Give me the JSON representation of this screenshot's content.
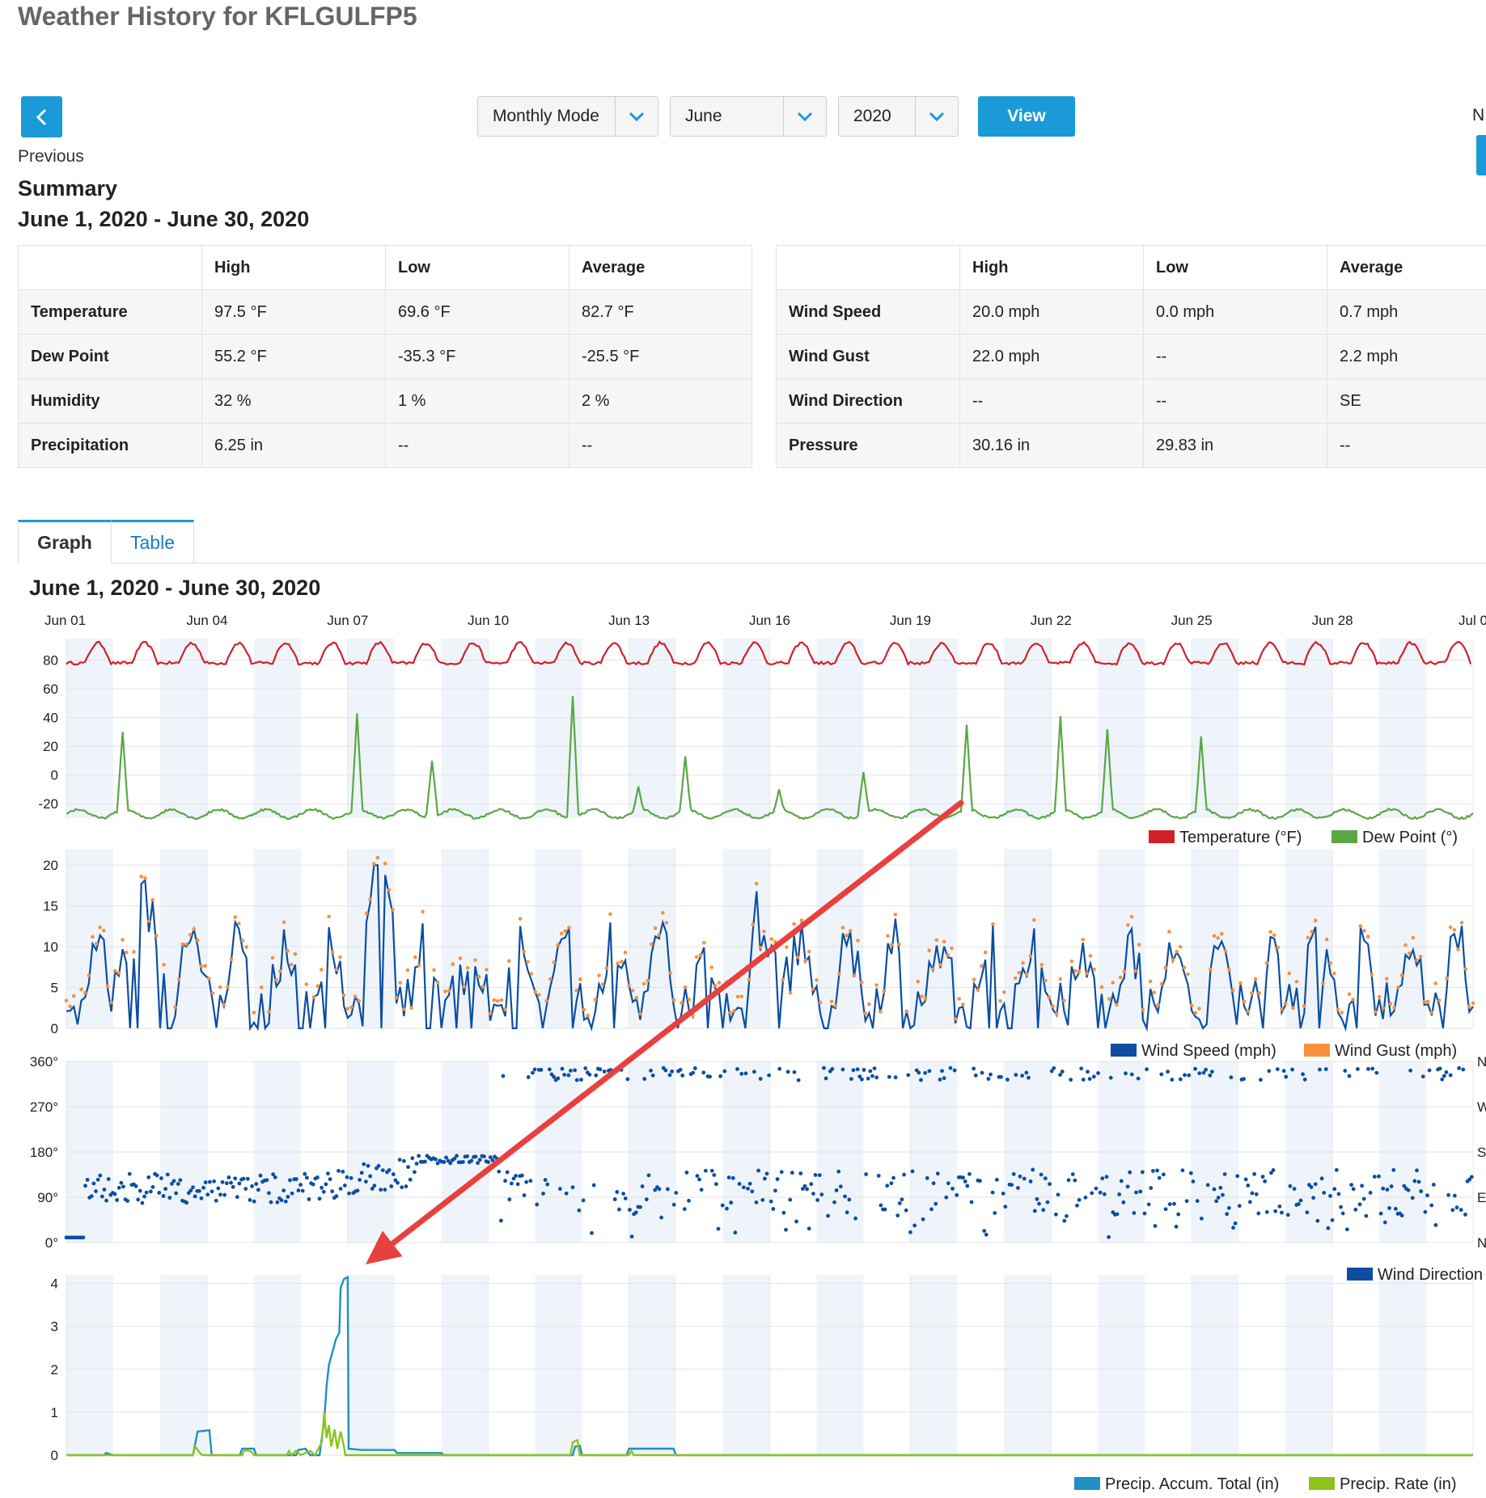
{
  "header": {
    "title": "Weather History for KFLGULFP5"
  },
  "nav": {
    "previous_label": "Previous",
    "next_label": "N",
    "mode_select": "Monthly Mode",
    "month_select": "June",
    "year_select": "2020",
    "view_label": "View"
  },
  "summary": {
    "title": "Summary",
    "range": "June 1, 2020 - June 30, 2020",
    "left_table": {
      "headers": [
        "",
        "High",
        "Low",
        "Average"
      ],
      "rows": [
        [
          "Temperature",
          "97.5 °F",
          "69.6 °F",
          "82.7 °F"
        ],
        [
          "Dew Point",
          "55.2 °F",
          "-35.3 °F",
          "-25.5 °F"
        ],
        [
          "Humidity",
          "32 %",
          "1 %",
          "2 %"
        ],
        [
          "Precipitation",
          "6.25 in",
          "--",
          "--"
        ]
      ]
    },
    "right_table": {
      "headers": [
        "",
        "High",
        "Low",
        "Average"
      ],
      "rows": [
        [
          "Wind Speed",
          "20.0 mph",
          "0.0 mph",
          "0.7 mph"
        ],
        [
          "Wind Gust",
          "22.0 mph",
          "--",
          "2.2 mph"
        ],
        [
          "Wind Direction",
          "--",
          "--",
          "SE"
        ],
        [
          "Pressure",
          "30.16 in",
          "29.83 in",
          "--"
        ]
      ]
    }
  },
  "tabs": {
    "graph": "Graph",
    "table": "Table"
  },
  "graph": {
    "range": "June 1, 2020 - June 30, 2020",
    "x_ticks": [
      "Jun 01",
      "Jun 04",
      "Jun 07",
      "Jun 10",
      "Jun 13",
      "Jun 16",
      "Jun 19",
      "Jun 22",
      "Jun 25",
      "Jun 28",
      "Jul 0"
    ]
  },
  "colors": {
    "accent": "#1a9ad6",
    "temperature": "#d0212b",
    "dew_point": "#5aa745",
    "wind_speed": "#0b4ea2",
    "wind_gust": "#f7913d",
    "wind_direction": "#0b4ea2",
    "precip_accum": "#1e90c3",
    "precip_rate": "#8cc41b",
    "annotation_arrow": "#e8403e"
  },
  "chart_data": [
    {
      "type": "line",
      "xlim": [
        "2020-06-01",
        "2020-07-01"
      ],
      "ylim": [
        -30,
        95
      ],
      "yticks": [
        "80",
        "60",
        "40",
        "20",
        "0",
        "-20"
      ],
      "legend": "bottom-right",
      "series": [
        {
          "name": "Temperature (°F)",
          "kind": "diurnal",
          "base": 82,
          "amp": 10
        },
        {
          "name": "Dew Point (°)",
          "kind": "spiky",
          "base": -27,
          "spikes": [
            [
              1.2,
              30
            ],
            [
              6.2,
              43
            ],
            [
              7.8,
              10
            ],
            [
              10.8,
              55
            ],
            [
              12.2,
              -8
            ],
            [
              13.2,
              13
            ],
            [
              15.2,
              -10
            ],
            [
              17.0,
              2
            ],
            [
              19.2,
              35
            ],
            [
              21.2,
              41
            ],
            [
              22.2,
              32
            ],
            [
              24.2,
              27
            ]
          ]
        }
      ]
    },
    {
      "type": "line",
      "xlim": [
        "2020-06-01",
        "2020-07-01"
      ],
      "ylim": [
        0,
        22
      ],
      "yticks": [
        "20",
        "15",
        "10",
        "5",
        "0"
      ],
      "legend": "bottom-right",
      "series": [
        {
          "name": "Wind Speed (mph)",
          "peak_day": "2020-06-07",
          "peak": 20
        },
        {
          "name": "Wind Gust (mph)",
          "peak_day": "2020-06-07",
          "peak": 22
        }
      ]
    },
    {
      "type": "scatter",
      "xlim": [
        "2020-06-01",
        "2020-07-01"
      ],
      "ylim": [
        0,
        360
      ],
      "yticks": [
        "360°",
        "270°",
        "180°",
        "90°",
        "0°"
      ],
      "right_ticks": [
        "N",
        "W",
        "S",
        "E",
        "N"
      ],
      "legend": "bottom-right",
      "series": [
        {
          "name": "Wind Direction"
        }
      ]
    },
    {
      "type": "line",
      "xlim": [
        "2020-06-01",
        "2020-07-01"
      ],
      "ylim": [
        0,
        4.2
      ],
      "yticks": [
        "4",
        "3",
        "2",
        "1",
        "0"
      ],
      "legend": "bottom-right",
      "series": [
        {
          "name": "Precip. Accum. Total (in)",
          "points": [
            [
              0,
              0
            ],
            [
              0.8,
              0
            ],
            [
              0.85,
              0.05
            ],
            [
              1.0,
              0
            ],
            [
              2.7,
              0
            ],
            [
              2.8,
              0.55
            ],
            [
              3.05,
              0.58
            ],
            [
              3.1,
              0
            ],
            [
              3.7,
              0
            ],
            [
              3.75,
              0.15
            ],
            [
              4.0,
              0.15
            ],
            [
              4.05,
              0
            ],
            [
              4.9,
              0
            ],
            [
              4.95,
              0.12
            ],
            [
              5.1,
              0.15
            ],
            [
              5.2,
              0
            ],
            [
              5.4,
              0
            ],
            [
              5.5,
              0.8
            ],
            [
              5.55,
              1.6
            ],
            [
              5.6,
              2.1
            ],
            [
              5.65,
              2.3
            ],
            [
              5.7,
              2.5
            ],
            [
              5.75,
              2.7
            ],
            [
              5.82,
              2.85
            ],
            [
              5.85,
              3.9
            ],
            [
              5.92,
              4.1
            ],
            [
              6.0,
              4.15
            ],
            [
              6.02,
              0.15
            ],
            [
              6.3,
              0.12
            ],
            [
              7.0,
              0.12
            ],
            [
              7.05,
              0.05
            ],
            [
              8.0,
              0.05
            ],
            [
              8.05,
              0
            ],
            [
              10.8,
              0
            ],
            [
              10.85,
              0.2
            ],
            [
              10.95,
              0.22
            ],
            [
              11.0,
              0
            ],
            [
              11.95,
              0
            ],
            [
              12.0,
              0.15
            ],
            [
              12.95,
              0.15
            ],
            [
              13.0,
              0
            ],
            [
              30,
              0
            ]
          ]
        },
        {
          "name": "Precip. Rate (in)",
          "points": [
            [
              0,
              0
            ],
            [
              2.7,
              0
            ],
            [
              2.75,
              0.2
            ],
            [
              2.85,
              0.05
            ],
            [
              2.9,
              0
            ],
            [
              3.75,
              0
            ],
            [
              3.8,
              0.12
            ],
            [
              3.95,
              0.08
            ],
            [
              4.0,
              0
            ],
            [
              4.7,
              0
            ],
            [
              4.75,
              0.1
            ],
            [
              4.8,
              0
            ],
            [
              4.9,
              0.1
            ],
            [
              5.0,
              0
            ],
            [
              5.2,
              0.1
            ],
            [
              5.3,
              0
            ],
            [
              5.45,
              0.3
            ],
            [
              5.5,
              1.0
            ],
            [
              5.55,
              0.4
            ],
            [
              5.6,
              0.7
            ],
            [
              5.65,
              0.2
            ],
            [
              5.72,
              0.6
            ],
            [
              5.78,
              0.15
            ],
            [
              5.85,
              0.55
            ],
            [
              5.92,
              0.2
            ],
            [
              5.95,
              0
            ],
            [
              10.75,
              0
            ],
            [
              10.8,
              0.3
            ],
            [
              10.9,
              0.35
            ],
            [
              10.95,
              0
            ],
            [
              12.0,
              0
            ],
            [
              12.05,
              0.1
            ],
            [
              12.1,
              0
            ],
            [
              30,
              0
            ]
          ]
        }
      ]
    }
  ]
}
